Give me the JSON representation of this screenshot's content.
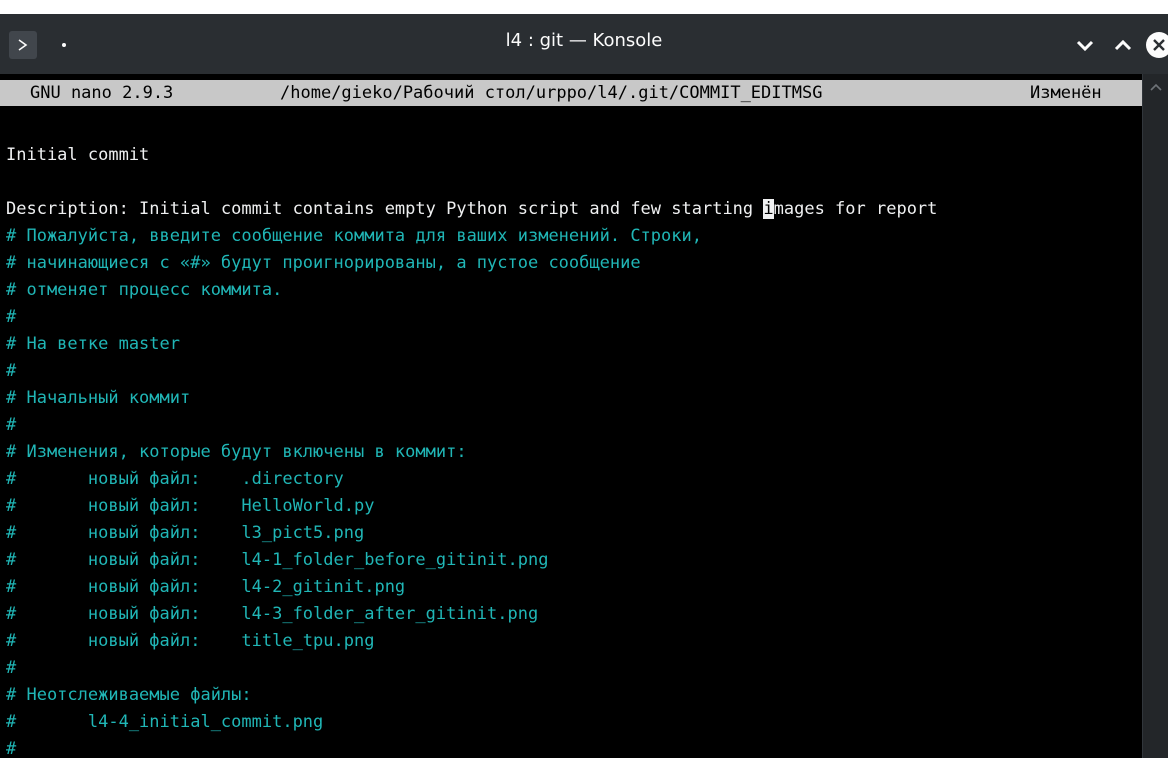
{
  "window": {
    "title": "l4 : git — Konsole",
    "app_button_icon": "terminal-prompt-icon",
    "titlebar_color": "#2a2e32",
    "buttons": {
      "minimize_icon": "chevron-down-icon",
      "maximize_icon": "chevron-up-icon",
      "close_icon": "close-icon"
    }
  },
  "nano": {
    "version": "GNU nano 2.9.3",
    "path": "/home/gieko/Рабочий стол/urppo/l4/.git/COMMIT_EDITMSG",
    "status": "Изменён"
  },
  "buffer": {
    "line1": "Initial commit",
    "line2": "",
    "line3_before_cursor": "Description: Initial commit contains empty Python script and few starting ",
    "line3_cursor_char": "i",
    "line3_after_cursor": "mages for report",
    "comments": [
      "# Пожалуйста, введите сообщение коммита для ваших изменений. Строки,",
      "# начинающиеся с «#» будут проигнорированы, а пустое сообщение",
      "# отменяет процесс коммита.",
      "#",
      "# На ветке master",
      "#",
      "# Начальный коммит",
      "#",
      "# Изменения, которые будут включены в коммит:",
      "#       новый файл:    .directory",
      "#       новый файл:    HelloWorld.py",
      "#       новый файл:    l3_pict5.png",
      "#       новый файл:    l4-1_folder_before_gitinit.png",
      "#       новый файл:    l4-2_gitinit.png",
      "#       новый файл:    l4-3_folder_after_gitinit.png",
      "#       новый файл:    title_tpu.png",
      "#",
      "# Неотслеживаемые файлы:",
      "#       l4-4_initial_commit.png",
      "#"
    ],
    "colors": {
      "text": "#eff0f1",
      "comment": "#20b6b6",
      "header_bg": "#c8c8c8"
    }
  }
}
